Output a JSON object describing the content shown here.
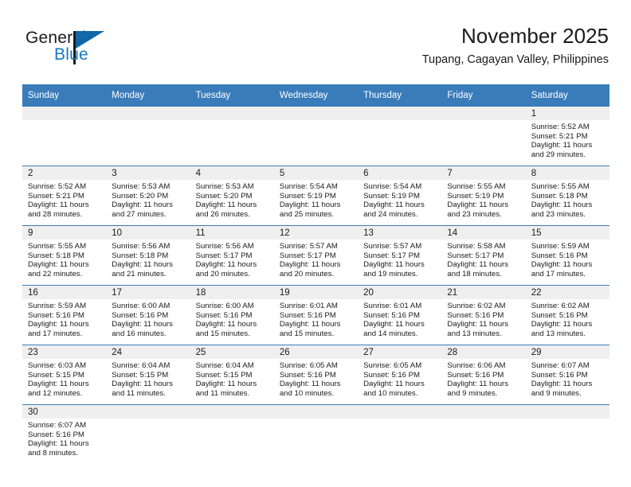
{
  "brand": {
    "line1": "General",
    "line2": "Blue",
    "accent_color": "#1878be",
    "triangle_color": "#1167a8"
  },
  "header": {
    "title": "November 2025",
    "subtitle": "Tupang, Cagayan Valley, Philippines"
  },
  "theme": {
    "header_band": "#3a7cba",
    "daynum_band": "#efefef",
    "text": "#1b1b1b",
    "grid_line": "#3a7cba"
  },
  "calendar": {
    "weekday_headers": [
      "Sunday",
      "Monday",
      "Tuesday",
      "Wednesday",
      "Thursday",
      "Friday",
      "Saturday"
    ],
    "labels": {
      "sunrise": "Sunrise:",
      "sunset": "Sunset:",
      "daylight": "Daylight:"
    },
    "weeks": [
      [
        {
          "day": "",
          "sunrise": "",
          "sunset": "",
          "daylight_a": "",
          "daylight_b": ""
        },
        {
          "day": "",
          "sunrise": "",
          "sunset": "",
          "daylight_a": "",
          "daylight_b": ""
        },
        {
          "day": "",
          "sunrise": "",
          "sunset": "",
          "daylight_a": "",
          "daylight_b": ""
        },
        {
          "day": "",
          "sunrise": "",
          "sunset": "",
          "daylight_a": "",
          "daylight_b": ""
        },
        {
          "day": "",
          "sunrise": "",
          "sunset": "",
          "daylight_a": "",
          "daylight_b": ""
        },
        {
          "day": "",
          "sunrise": "",
          "sunset": "",
          "daylight_a": "",
          "daylight_b": ""
        },
        {
          "day": "1",
          "sunrise": "Sunrise: 5:52 AM",
          "sunset": "Sunset: 5:21 PM",
          "daylight_a": "Daylight: 11 hours",
          "daylight_b": "and 29 minutes."
        }
      ],
      [
        {
          "day": "2",
          "sunrise": "Sunrise: 5:52 AM",
          "sunset": "Sunset: 5:21 PM",
          "daylight_a": "Daylight: 11 hours",
          "daylight_b": "and 28 minutes."
        },
        {
          "day": "3",
          "sunrise": "Sunrise: 5:53 AM",
          "sunset": "Sunset: 5:20 PM",
          "daylight_a": "Daylight: 11 hours",
          "daylight_b": "and 27 minutes."
        },
        {
          "day": "4",
          "sunrise": "Sunrise: 5:53 AM",
          "sunset": "Sunset: 5:20 PM",
          "daylight_a": "Daylight: 11 hours",
          "daylight_b": "and 26 minutes."
        },
        {
          "day": "5",
          "sunrise": "Sunrise: 5:54 AM",
          "sunset": "Sunset: 5:19 PM",
          "daylight_a": "Daylight: 11 hours",
          "daylight_b": "and 25 minutes."
        },
        {
          "day": "6",
          "sunrise": "Sunrise: 5:54 AM",
          "sunset": "Sunset: 5:19 PM",
          "daylight_a": "Daylight: 11 hours",
          "daylight_b": "and 24 minutes."
        },
        {
          "day": "7",
          "sunrise": "Sunrise: 5:55 AM",
          "sunset": "Sunset: 5:19 PM",
          "daylight_a": "Daylight: 11 hours",
          "daylight_b": "and 23 minutes."
        },
        {
          "day": "8",
          "sunrise": "Sunrise: 5:55 AM",
          "sunset": "Sunset: 5:18 PM",
          "daylight_a": "Daylight: 11 hours",
          "daylight_b": "and 23 minutes."
        }
      ],
      [
        {
          "day": "9",
          "sunrise": "Sunrise: 5:55 AM",
          "sunset": "Sunset: 5:18 PM",
          "daylight_a": "Daylight: 11 hours",
          "daylight_b": "and 22 minutes."
        },
        {
          "day": "10",
          "sunrise": "Sunrise: 5:56 AM",
          "sunset": "Sunset: 5:18 PM",
          "daylight_a": "Daylight: 11 hours",
          "daylight_b": "and 21 minutes."
        },
        {
          "day": "11",
          "sunrise": "Sunrise: 5:56 AM",
          "sunset": "Sunset: 5:17 PM",
          "daylight_a": "Daylight: 11 hours",
          "daylight_b": "and 20 minutes."
        },
        {
          "day": "12",
          "sunrise": "Sunrise: 5:57 AM",
          "sunset": "Sunset: 5:17 PM",
          "daylight_a": "Daylight: 11 hours",
          "daylight_b": "and 20 minutes."
        },
        {
          "day": "13",
          "sunrise": "Sunrise: 5:57 AM",
          "sunset": "Sunset: 5:17 PM",
          "daylight_a": "Daylight: 11 hours",
          "daylight_b": "and 19 minutes."
        },
        {
          "day": "14",
          "sunrise": "Sunrise: 5:58 AM",
          "sunset": "Sunset: 5:17 PM",
          "daylight_a": "Daylight: 11 hours",
          "daylight_b": "and 18 minutes."
        },
        {
          "day": "15",
          "sunrise": "Sunrise: 5:59 AM",
          "sunset": "Sunset: 5:16 PM",
          "daylight_a": "Daylight: 11 hours",
          "daylight_b": "and 17 minutes."
        }
      ],
      [
        {
          "day": "16",
          "sunrise": "Sunrise: 5:59 AM",
          "sunset": "Sunset: 5:16 PM",
          "daylight_a": "Daylight: 11 hours",
          "daylight_b": "and 17 minutes."
        },
        {
          "day": "17",
          "sunrise": "Sunrise: 6:00 AM",
          "sunset": "Sunset: 5:16 PM",
          "daylight_a": "Daylight: 11 hours",
          "daylight_b": "and 16 minutes."
        },
        {
          "day": "18",
          "sunrise": "Sunrise: 6:00 AM",
          "sunset": "Sunset: 5:16 PM",
          "daylight_a": "Daylight: 11 hours",
          "daylight_b": "and 15 minutes."
        },
        {
          "day": "19",
          "sunrise": "Sunrise: 6:01 AM",
          "sunset": "Sunset: 5:16 PM",
          "daylight_a": "Daylight: 11 hours",
          "daylight_b": "and 15 minutes."
        },
        {
          "day": "20",
          "sunrise": "Sunrise: 6:01 AM",
          "sunset": "Sunset: 5:16 PM",
          "daylight_a": "Daylight: 11 hours",
          "daylight_b": "and 14 minutes."
        },
        {
          "day": "21",
          "sunrise": "Sunrise: 6:02 AM",
          "sunset": "Sunset: 5:16 PM",
          "daylight_a": "Daylight: 11 hours",
          "daylight_b": "and 13 minutes."
        },
        {
          "day": "22",
          "sunrise": "Sunrise: 6:02 AM",
          "sunset": "Sunset: 5:16 PM",
          "daylight_a": "Daylight: 11 hours",
          "daylight_b": "and 13 minutes."
        }
      ],
      [
        {
          "day": "23",
          "sunrise": "Sunrise: 6:03 AM",
          "sunset": "Sunset: 5:15 PM",
          "daylight_a": "Daylight: 11 hours",
          "daylight_b": "and 12 minutes."
        },
        {
          "day": "24",
          "sunrise": "Sunrise: 6:04 AM",
          "sunset": "Sunset: 5:15 PM",
          "daylight_a": "Daylight: 11 hours",
          "daylight_b": "and 11 minutes."
        },
        {
          "day": "25",
          "sunrise": "Sunrise: 6:04 AM",
          "sunset": "Sunset: 5:15 PM",
          "daylight_a": "Daylight: 11 hours",
          "daylight_b": "and 11 minutes."
        },
        {
          "day": "26",
          "sunrise": "Sunrise: 6:05 AM",
          "sunset": "Sunset: 5:16 PM",
          "daylight_a": "Daylight: 11 hours",
          "daylight_b": "and 10 minutes."
        },
        {
          "day": "27",
          "sunrise": "Sunrise: 6:05 AM",
          "sunset": "Sunset: 5:16 PM",
          "daylight_a": "Daylight: 11 hours",
          "daylight_b": "and 10 minutes."
        },
        {
          "day": "28",
          "sunrise": "Sunrise: 6:06 AM",
          "sunset": "Sunset: 5:16 PM",
          "daylight_a": "Daylight: 11 hours",
          "daylight_b": "and 9 minutes."
        },
        {
          "day": "29",
          "sunrise": "Sunrise: 6:07 AM",
          "sunset": "Sunset: 5:16 PM",
          "daylight_a": "Daylight: 11 hours",
          "daylight_b": "and 9 minutes."
        }
      ],
      [
        {
          "day": "30",
          "sunrise": "Sunrise: 6:07 AM",
          "sunset": "Sunset: 5:16 PM",
          "daylight_a": "Daylight: 11 hours",
          "daylight_b": "and 8 minutes."
        },
        {
          "day": "",
          "sunrise": "",
          "sunset": "",
          "daylight_a": "",
          "daylight_b": ""
        },
        {
          "day": "",
          "sunrise": "",
          "sunset": "",
          "daylight_a": "",
          "daylight_b": ""
        },
        {
          "day": "",
          "sunrise": "",
          "sunset": "",
          "daylight_a": "",
          "daylight_b": ""
        },
        {
          "day": "",
          "sunrise": "",
          "sunset": "",
          "daylight_a": "",
          "daylight_b": ""
        },
        {
          "day": "",
          "sunrise": "",
          "sunset": "",
          "daylight_a": "",
          "daylight_b": ""
        },
        {
          "day": "",
          "sunrise": "",
          "sunset": "",
          "daylight_a": "",
          "daylight_b": ""
        }
      ]
    ]
  }
}
